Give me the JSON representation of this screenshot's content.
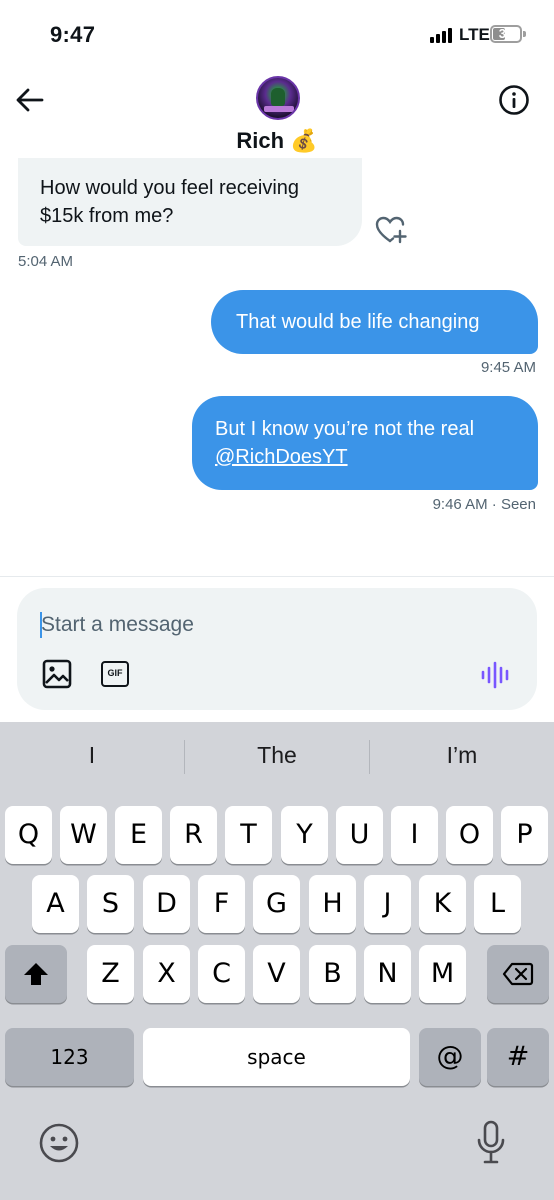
{
  "status_bar": {
    "time": "9:47",
    "network": "LTE",
    "battery": "37"
  },
  "header": {
    "name": "Rich 💰",
    "back_icon": "arrow-left-icon",
    "info_icon": "info-circle-icon"
  },
  "messages": [
    {
      "direction": "incoming",
      "text": "How would you feel receiving $15k from me?",
      "time": "5:04 AM"
    },
    {
      "direction": "outgoing",
      "text": "That would be life changing",
      "time": "9:45 AM"
    },
    {
      "direction": "outgoing",
      "text_prefix": "But I know you’re not the real",
      "mention": "@RichDoesYT",
      "time": "9:46 AM",
      "status": "· Seen"
    }
  ],
  "composer": {
    "placeholder": "Start a message",
    "gif_label": "GIF"
  },
  "keyboard": {
    "suggestions": [
      "I",
      "The",
      "I’m"
    ],
    "row1": [
      "Q",
      "W",
      "E",
      "R",
      "T",
      "Y",
      "U",
      "I",
      "O",
      "P"
    ],
    "row2": [
      "A",
      "S",
      "D",
      "F",
      "G",
      "H",
      "J",
      "K",
      "L"
    ],
    "row3": [
      "Z",
      "X",
      "C",
      "V",
      "B",
      "N",
      "M"
    ],
    "numbers_key": "123",
    "space_key": "space",
    "at_key": "@",
    "hash_key": "#"
  },
  "colors": {
    "accent": "#3b94e8",
    "incoming_bubble": "#eff3f4",
    "muted_text": "#536471",
    "voice_icon": "#7856ff"
  }
}
